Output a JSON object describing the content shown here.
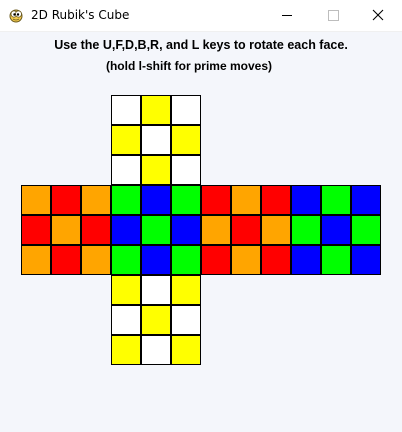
{
  "window": {
    "title": "2D Rubik's Cube",
    "minimize_icon": "minimize-icon",
    "maximize_icon": "maximize-icon",
    "close_icon": "close-icon",
    "app_icon": "pygame-snake-icon"
  },
  "instructions": {
    "line1": "Use the U,F,D,B,R, and L keys to rotate each face.",
    "line2": "(hold l-shift for prime moves)"
  },
  "colors": {
    "W": "#ffffff",
    "Y": "#ffff00",
    "O": "#ffa500",
    "R": "#ff0000",
    "G": "#00ff00",
    "B": "#0000ff"
  },
  "cube": {
    "up": [
      [
        "W",
        "Y",
        "W"
      ],
      [
        "Y",
        "W",
        "Y"
      ],
      [
        "W",
        "Y",
        "W"
      ]
    ],
    "middle_rows": [
      [
        "O",
        "R",
        "O",
        "G",
        "B",
        "G",
        "R",
        "O",
        "R",
        "B",
        "G",
        "B"
      ],
      [
        "R",
        "O",
        "R",
        "B",
        "G",
        "B",
        "O",
        "R",
        "O",
        "G",
        "B",
        "G"
      ],
      [
        "O",
        "R",
        "O",
        "G",
        "B",
        "G",
        "R",
        "O",
        "R",
        "B",
        "G",
        "B"
      ]
    ],
    "down": [
      [
        "Y",
        "W",
        "Y"
      ],
      [
        "W",
        "Y",
        "W"
      ],
      [
        "Y",
        "W",
        "Y"
      ]
    ]
  }
}
